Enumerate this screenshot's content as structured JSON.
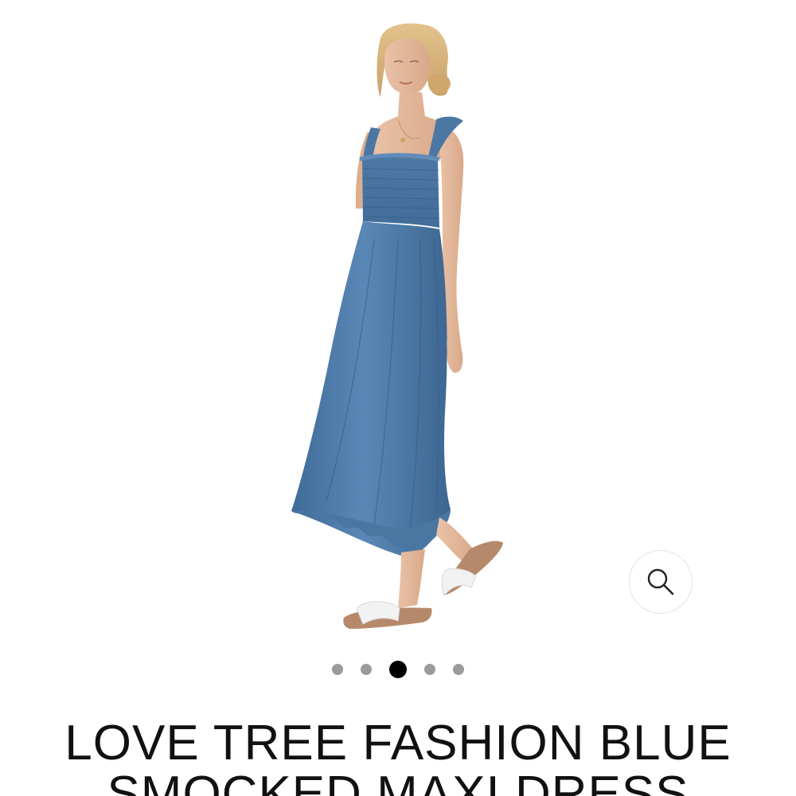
{
  "product": {
    "title": "LOVE TREE FASHION BLUE\nSMOCKED MAXI DRESS",
    "image_subject": "model wearing blue chambray smocked maxi dress with ruffle hem and white slide sandals"
  },
  "gallery": {
    "slide_count": 5,
    "active_slide": 3,
    "zoom_icon": "magnifier-icon"
  },
  "colors": {
    "dress": "#4a78a6",
    "dot_inactive": "#9b9b9b",
    "dot_active": "#000000",
    "text": "#111111"
  }
}
